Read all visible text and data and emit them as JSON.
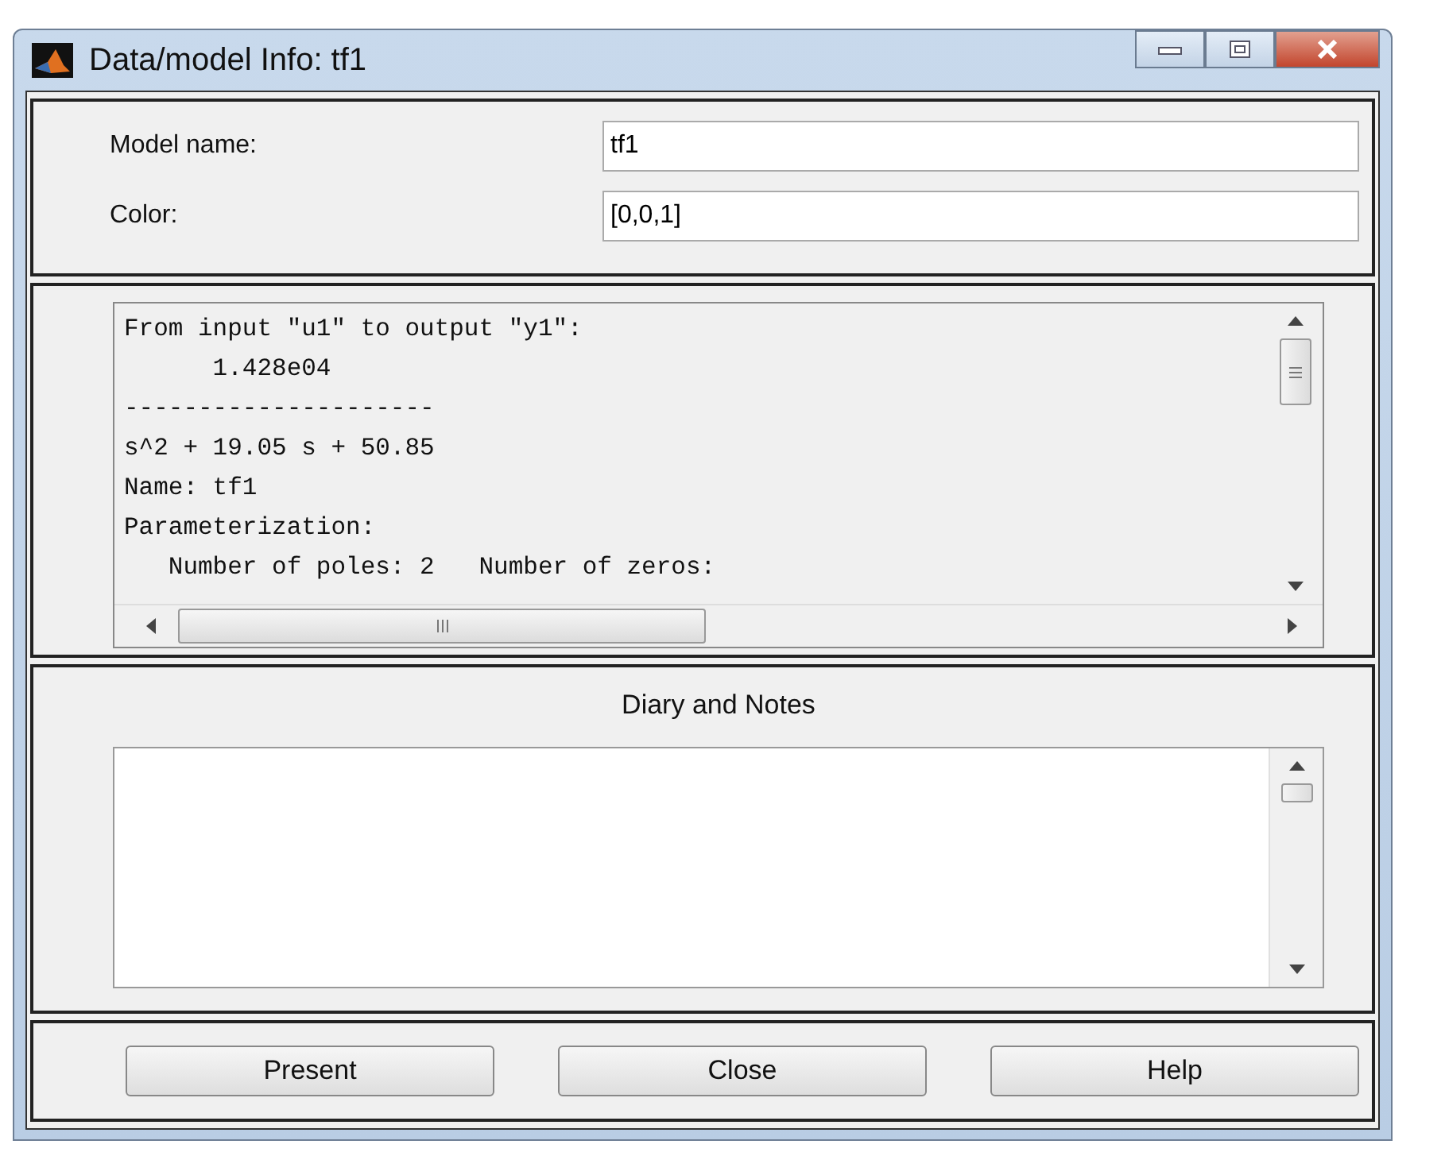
{
  "window": {
    "title": "Data/model Info: tf1"
  },
  "fields": [
    {
      "label": "Model name:",
      "value": "tf1"
    },
    {
      "label": "Color:",
      "value": "[0,0,1]"
    }
  ],
  "info_text": [
    "From input \"u1\" to output \"y1\":",
    "      1.428e04",
    "---------------------",
    "s^2 + 19.05 s + 50.85",
    "Name: tf1",
    "Parameterization:",
    "   Number of poles: 2   Number of zeros:"
  ],
  "diary": {
    "title": "Diary and Notes"
  },
  "buttons": [
    "Present",
    "Close",
    "Help"
  ]
}
